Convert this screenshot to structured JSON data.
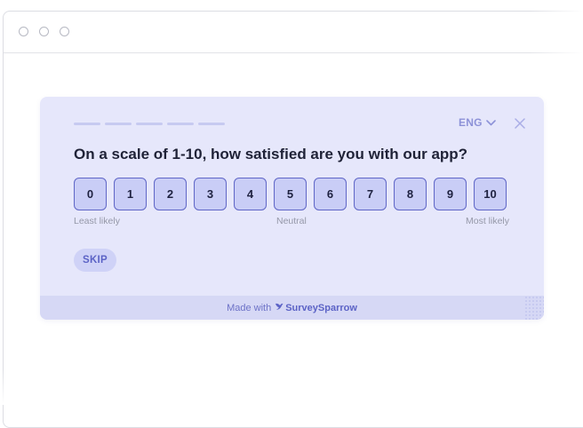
{
  "survey": {
    "progress_segments": 5,
    "language": "ENG",
    "question": "On a scale of 1-10, how satisfied are you with our app?",
    "scale": [
      "0",
      "1",
      "2",
      "3",
      "4",
      "5",
      "6",
      "7",
      "8",
      "9",
      "10"
    ],
    "labels": {
      "low": "Least likely",
      "mid": "Neutral",
      "high": "Most likely"
    },
    "skip_label": "SKIP"
  },
  "footer": {
    "made_with": "Made with",
    "brand": "SurveySparrow"
  },
  "icons": {
    "language": "chevron-down-icon",
    "close": "close-icon",
    "brand": "sparrow-logo-icon"
  },
  "colors": {
    "card_bg": "#e6e7fb",
    "accent": "#5f66c7",
    "button_fill": "#c9cdf6"
  }
}
